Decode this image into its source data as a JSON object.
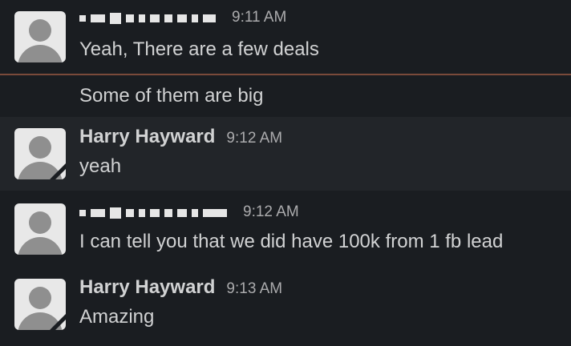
{
  "messages": [
    {
      "author": "",
      "author_redacted": true,
      "time": "9:11 AM",
      "text": "Yeah, There are a few deals"
    },
    {
      "continuation": true,
      "text": "Some of them are big"
    },
    {
      "author": "Harry Hayward",
      "time": "9:12 AM",
      "text": "yeah"
    },
    {
      "author": "",
      "author_redacted": true,
      "time": "9:12 AM",
      "text": "I can tell you that we did have 100k from 1 fb lead"
    },
    {
      "author": "Harry Hayward",
      "time": "9:13 AM",
      "text": "Amazing"
    }
  ],
  "colors": {
    "background": "#1a1d21",
    "hover_background": "#222529",
    "divider": "#7a4a3a",
    "text": "#d1d2d3",
    "timestamp": "#ababad"
  },
  "icons": [
    "default-avatar-icon"
  ]
}
